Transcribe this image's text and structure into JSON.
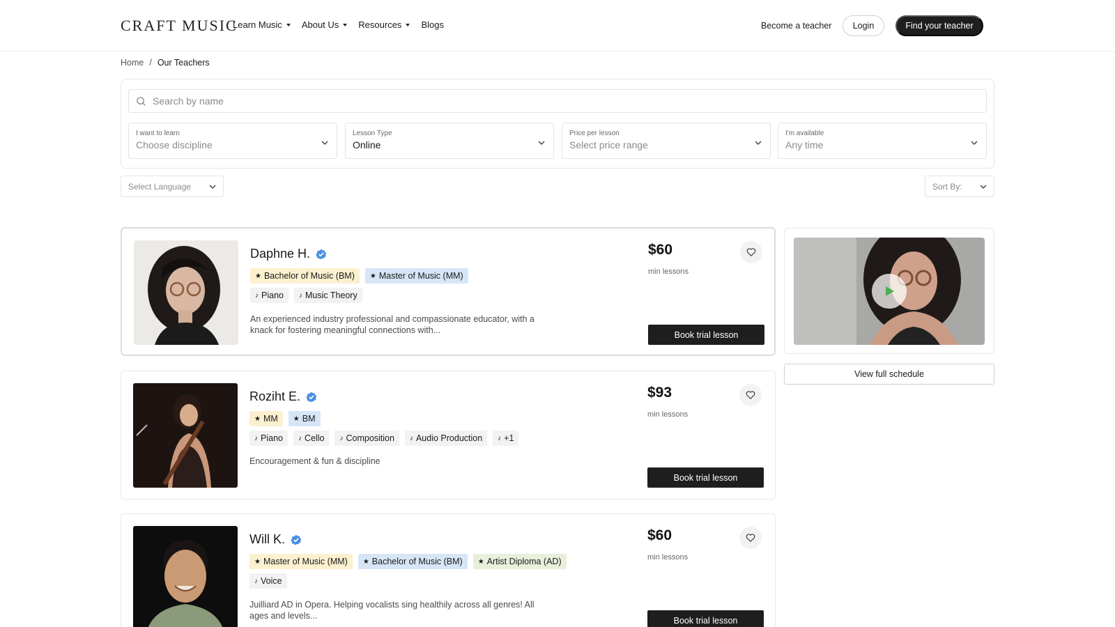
{
  "header": {
    "logo": "CRAFT MUSIC",
    "nav": [
      {
        "label": "Learn Music",
        "has_dropdown": true
      },
      {
        "label": "About Us",
        "has_dropdown": true
      },
      {
        "label": "Resources",
        "has_dropdown": true
      },
      {
        "label": "Blogs",
        "has_dropdown": false
      }
    ],
    "become_teacher": "Become a teacher",
    "login": "Login",
    "find_teacher": "Find your teacher"
  },
  "breadcrumb": {
    "home": "Home",
    "separator": "/",
    "current": "Our Teachers"
  },
  "filters": {
    "search_placeholder": "Search by name",
    "discipline": {
      "label": "I want to learn",
      "value": "Choose discipline"
    },
    "lesson_type": {
      "label": "Lesson Type",
      "value": "Online"
    },
    "price": {
      "label": "Price per lesson",
      "value": "Select price range"
    },
    "availability": {
      "label": "I'm available",
      "value": "Any time"
    },
    "language": "Select Language",
    "sort": "Sort By:"
  },
  "teachers": [
    {
      "name": "Daphne H.",
      "degrees": [
        "Bachelor of Music (BM)",
        "Master of Music (MM)"
      ],
      "instruments": [
        "Piano",
        "Music Theory"
      ],
      "description": "An experienced industry professional and compassionate educator, with a knack for fostering meaningful connections with...",
      "price": "$60",
      "price_note": "min lessons",
      "book": "Book trial lesson"
    },
    {
      "name": "Roziht E.",
      "degrees": [
        "MM",
        "BM"
      ],
      "instruments": [
        "Piano",
        "Cello",
        "Composition",
        "Audio Production",
        "+1"
      ],
      "description": "Encouragement & fun & discipline",
      "price": "$93",
      "price_note": "min lessons",
      "book": "Book trial lesson"
    },
    {
      "name": "Will K.",
      "degrees": [
        "Master of Music (MM)",
        "Bachelor of Music (BM)",
        "Artist Diploma (AD)"
      ],
      "instruments": [
        "Voice"
      ],
      "description": "Juilliard AD in Opera. Helping vocalists sing healthily across all genres! All ages and levels...",
      "price": "$60",
      "price_note": "min lessons",
      "book": "Book trial lesson"
    }
  ],
  "video_panel": {
    "schedule_button": "View full schedule"
  },
  "colors": {
    "verified": "#4a90e2",
    "primary_button": "#1e1e1e",
    "play_icon": "#4caf50"
  }
}
